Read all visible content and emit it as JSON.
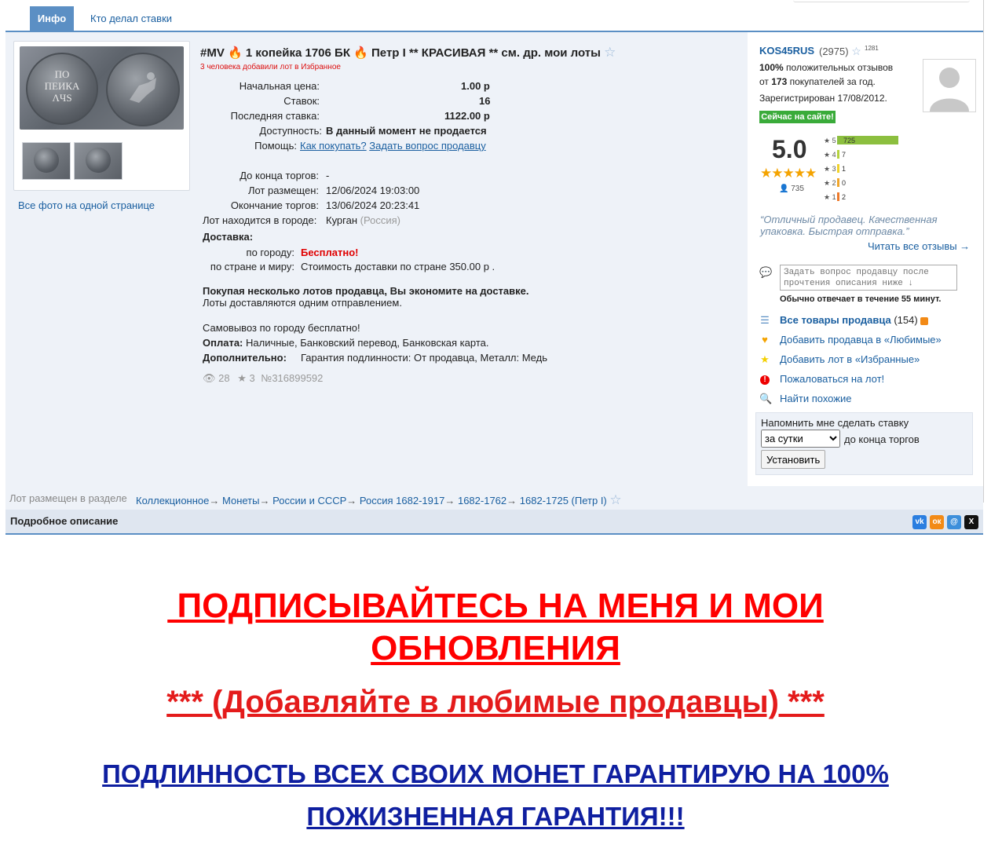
{
  "tabs": [
    {
      "label": "Инфо",
      "active": true
    },
    {
      "label": "Кто делал ставки",
      "active": false
    }
  ],
  "lot": {
    "title_parts": [
      "#MV",
      "1 копейка 1706 БК",
      "Петр I ** КРАСИВАЯ ** см. др. мои лоты"
    ],
    "fav_note": "3 человека добавили лот в Избранное",
    "all_photos": "Все фото на одной странице",
    "coin_text": "ПО\nПЕИКА\nΛЧS",
    "fields": {
      "start_price_label": "Начальная цена:",
      "start_price": "1.00 р",
      "bids_label": "Ставок:",
      "bids": "16",
      "last_bid_label": "Последняя ставка:",
      "last_bid": "1122.00 р",
      "availability_label": "Доступность:",
      "availability": "В данный момент не продается",
      "help_label": "Помощь:",
      "help_how": "Как покупать?",
      "help_ask": "Задать вопрос продавцу",
      "ends_in_label": "До конца торгов:",
      "ends_in": "-",
      "placed_label": "Лот размещен:",
      "placed": "12/06/2024 19:03:00",
      "end_label": "Окончание торгов:",
      "end": "13/06/2024 20:23:41",
      "city_label": "Лот находится в городе:",
      "city": "Курган",
      "country": "(Россия)"
    },
    "delivery": {
      "title": "Доставка:",
      "city_label": "по городу:",
      "city_value": "Бесплатно!",
      "country_label": "по стране и миру:",
      "country_value": "Стоимость доставки по стране 350.00 р ."
    },
    "multi_buy_bold": "Покупая несколько лотов продавца, Вы экономите на доставке.",
    "multi_buy_text": "Лоты доставляются одним отправлением.",
    "pickup": "Самовывоз по городу бесплатно!",
    "payment_label": "Оплата:",
    "payment_value": "Наличные, Банковский перевод, Банковская карта.",
    "extra_label": "Дополнительно:",
    "extra_value": "Гарантия подлинности: От продавца, Металл: Медь",
    "views": "28",
    "favs": "3",
    "lot_number": "№316899592"
  },
  "seller": {
    "name": "KOS45RUS",
    "rating": "(2975)",
    "small_count": "1281",
    "positive_pct": "100%",
    "positive_text": "положительных отзывов",
    "from_text": "от",
    "buyers_count": "173",
    "buyers_text": "покупателей за год.",
    "registered": "Зарегистрирован 17/08/2012.",
    "online": "Сейчас на сайте!",
    "score": "5.0",
    "reviews_count": "735",
    "bars": [
      {
        "label": "5",
        "count": "725",
        "color": "#8cbf3f"
      },
      {
        "label": "4",
        "count": "7",
        "color": "#b5d23e"
      },
      {
        "label": "3",
        "count": "1",
        "color": "#f0d22a"
      },
      {
        "label": "2",
        "count": "0",
        "color": "#f0a52a"
      },
      {
        "label": "1",
        "count": "2",
        "color": "#ee7a2a"
      }
    ],
    "quote": "“Отличный продавец. Качественная упаковка. Быстрая отправка.”",
    "read_all": "Читать все отзывы →",
    "ask_placeholder": "Задать вопрос продавцу после прочтения описания ниже ↓",
    "reply_time": "Обычно отвечает в течение 55 минут.",
    "all_items": "Все товары продавца",
    "all_items_count": "(154)",
    "add_fav_seller": "Добавить продавца в «Любимые»",
    "add_fav_lot": "Добавить лот в «Избранные»",
    "complain": "Пожаловаться на лот!",
    "find_similar": "Найти похожие"
  },
  "reminder": {
    "label": "Напомнить мне сделать ставку",
    "selected": "за сутки",
    "after": "до конца торгов",
    "button": "Установить"
  },
  "breadcrumb": {
    "label": "Лот размещен в разделе",
    "items": [
      "Коллекционное",
      "Монеты",
      "России и СССР",
      "Россия 1682-1917",
      "1682-1762",
      "1682-1725 (Петр I)"
    ]
  },
  "description": {
    "title": "Подробное описание",
    "line1": " ПОДПИСЫВАЙТЕСЬ НА МЕНЯ И МОИ",
    "line2": "ОБНОВЛЕНИЯ",
    "line3": "*** (Добавляйте в любимые продавцы) ***",
    "line4": "ПОДЛИННОСТЬ ВСЕХ СВОИХ МОНЕТ ГАРАНТИРУЮ НА 100%",
    "line5": "ПОЖИЗНЕННАЯ ГАРАНТИЯ!!!"
  },
  "share": [
    {
      "name": "vk",
      "glyph": "vk",
      "color": "#2a7ee0"
    },
    {
      "name": "ok",
      "glyph": "ок",
      "color": "#f28a16"
    },
    {
      "name": "mailru",
      "glyph": "@",
      "color": "#3d8fdb"
    },
    {
      "name": "x",
      "glyph": "X",
      "color": "#111111"
    }
  ],
  "colors": {
    "accent": "#5b8fc4",
    "link": "#1a5fa0",
    "panel": "#eef2f8",
    "online": "#3aab3a",
    "promo_red": "#ff0000",
    "promo_blue": "#0f1fa0"
  }
}
